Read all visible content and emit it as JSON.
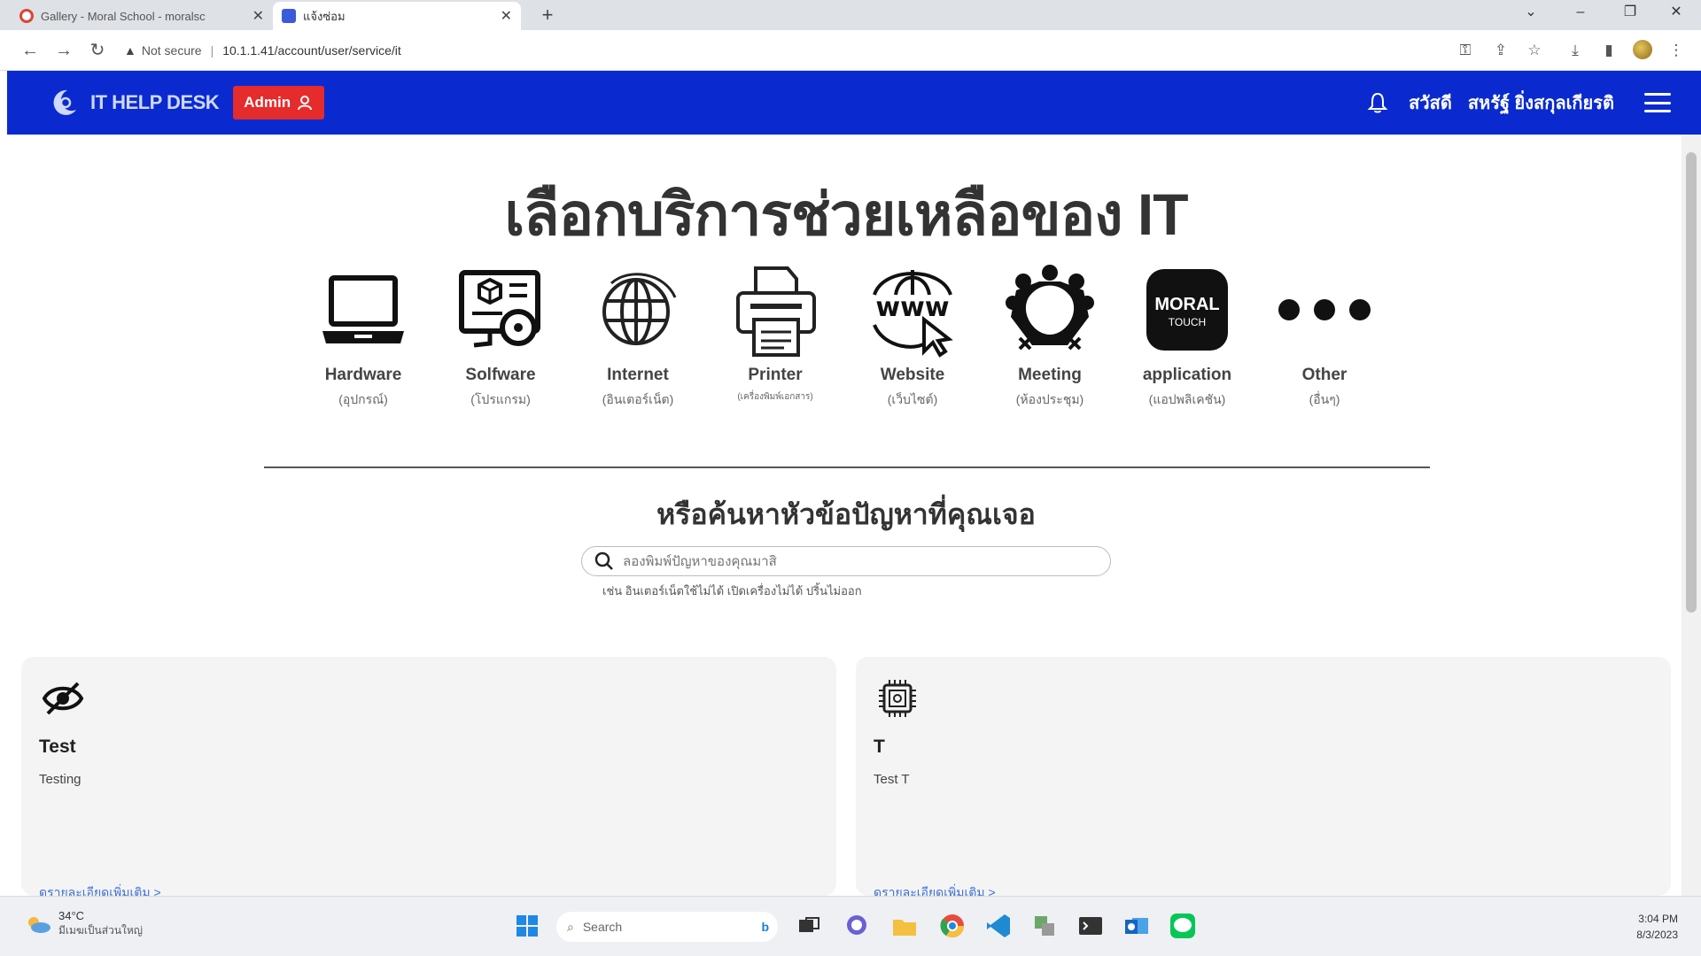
{
  "browser": {
    "tabs": [
      {
        "title": "Gallery - Moral School - moralsc",
        "active": false
      },
      {
        "title": "แจ้งซ่อม",
        "active": true
      }
    ],
    "security_label": "Not secure",
    "url": "10.1.1.41/account/user/service/it"
  },
  "header": {
    "brand": "IT HELP DESK",
    "role_badge": "Admin",
    "greeting": "สวัสดี",
    "user_name": "สหรัฐ์ ยิ่งสกุลเกียรติ",
    "colors": {
      "bar": "#0a2ad0",
      "admin": "#e52b2b"
    }
  },
  "main": {
    "title": "เลือกบริการช่วยเหลือของ IT",
    "services": [
      {
        "name": "Hardware",
        "sub": "(อุปกรณ์)",
        "icon": "laptop-icon"
      },
      {
        "name": "Solfware",
        "sub": "(โปรแกรม)",
        "icon": "software-icon"
      },
      {
        "name": "Internet",
        "sub": "(อินเตอร์เน็ต)",
        "icon": "globe-icon"
      },
      {
        "name": "Printer",
        "sub": "(เครื่องพิมพ์เอกสาร)",
        "icon": "printer-icon"
      },
      {
        "name": "Website",
        "sub": "(เว็บไซต์)",
        "icon": "www-icon"
      },
      {
        "name": "Meeting",
        "sub": "(ห้องประชุม)",
        "icon": "meeting-icon"
      },
      {
        "name": "application",
        "sub": "(แอปพลิเคชัน)",
        "icon": "moral-touch-icon"
      },
      {
        "name": "Other",
        "sub": "(อื่นๆ)",
        "icon": "more-dots-icon"
      }
    ],
    "search_title": "หรือค้นหาหัวข้อปัญหาที่คุณเจอ",
    "search_placeholder": "ลองพิมพ์ปัญหาของคุณมาสิ",
    "search_hint": "เช่น อินเตอร์เน็ตใช้ไม่ได้ เปิดเครื่องไม่ได้ ปริ้นไม่ออก",
    "cards": [
      {
        "title": "Test",
        "desc": "Testing",
        "link": "ดูรายละเอียดเพิ่มเติม >",
        "icon": "eye-slash-icon"
      },
      {
        "title": "T",
        "desc": "Test T",
        "link": "ดูรายละเอียดเพิ่มเติม >",
        "icon": "cpu-chip-icon"
      }
    ]
  },
  "taskbar": {
    "weather_temp": "34°C",
    "weather_cond": "มีเมฆเป็นส่วนใหญ่",
    "search_label": "Search",
    "time": "3:04 PM",
    "date": "8/3/2023"
  }
}
